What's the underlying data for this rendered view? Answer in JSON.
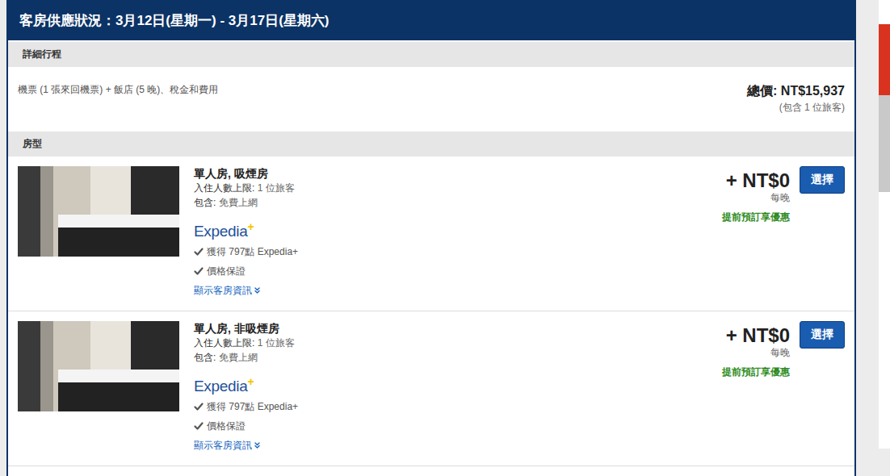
{
  "header": {
    "title": "客房供應狀況：3月12日(星期一) - 3月17日(星期六)"
  },
  "itinerary": {
    "heading": "詳細行程",
    "description": "機票 (1 張來回機票) + 飯店 (5 晚)、稅金和費用",
    "total": "總價: NT$15,937",
    "travelers": "(包含 1 位旅客)"
  },
  "rooms": {
    "heading": "房型",
    "items": [
      {
        "name": "單人房, 吸煙房",
        "occupancy_label": "入住人數上限:",
        "occupancy_value": "1 位旅客",
        "includes_label": "包含:",
        "includes_value": "免費上網",
        "brand": "Expedia",
        "brand_plus": "+",
        "points": "獲得 797點 Expedia+",
        "guarantee": "價格保證",
        "details_link": "顯示客房資訊",
        "price": "+ NT$0",
        "per": "每晚",
        "deal": "提前預訂享優惠",
        "button": "選擇"
      },
      {
        "name": "單人房, 非吸煙房",
        "occupancy_label": "入住人數上限:",
        "occupancy_value": "1 位旅客",
        "includes_label": "包含:",
        "includes_value": "免費上網",
        "brand": "Expedia",
        "brand_plus": "+",
        "points": "獲得 797點 Expedia+",
        "guarantee": "價格保證",
        "details_link": "顯示客房資訊",
        "price": "+ NT$0",
        "per": "每晚",
        "deal": "提前預訂享優惠",
        "button": "選擇"
      }
    ]
  }
}
